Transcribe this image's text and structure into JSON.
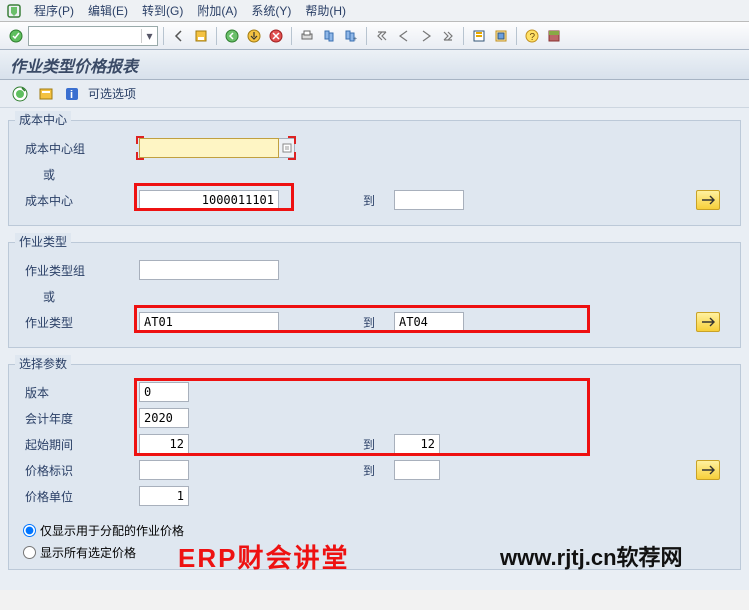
{
  "menu": {
    "program": "程序(P)",
    "edit": "编辑(E)",
    "goto": "转到(G)",
    "extras": "附加(A)",
    "system": "系统(Y)",
    "help": "帮助(H)"
  },
  "title": "作业类型价格报表",
  "sub_toolbar": {
    "optional": "可选选项"
  },
  "group1": {
    "title": "成本中心",
    "cost_center_group": "成本中心组",
    "or": "或",
    "cost_center": "成本中心",
    "cc_from": "1000011101",
    "cc_to": "",
    "to_label": "到"
  },
  "group2": {
    "title": "作业类型",
    "activity_group": "作业类型组",
    "or": "或",
    "activity_type": "作业类型",
    "at_from": "AT01",
    "at_to": "AT04",
    "to_label": "到"
  },
  "group3": {
    "title": "选择参数",
    "version": "版本",
    "version_val": "0",
    "fiscal_year": "会计年度",
    "fiscal_year_val": "2020",
    "start_period": "起始期间",
    "start_from": "12",
    "start_to": "12",
    "price_ind": "价格标识",
    "price_ind_from": "",
    "price_ind_to": "",
    "price_unit": "价格单位",
    "price_unit_val": "1",
    "to_label": "到",
    "radio1": "仅显示用于分配的作业价格",
    "radio2": "显示所有选定价格"
  },
  "watermark1": "ERP财会讲堂",
  "watermark2": "www.rjtj.cn软荐网"
}
